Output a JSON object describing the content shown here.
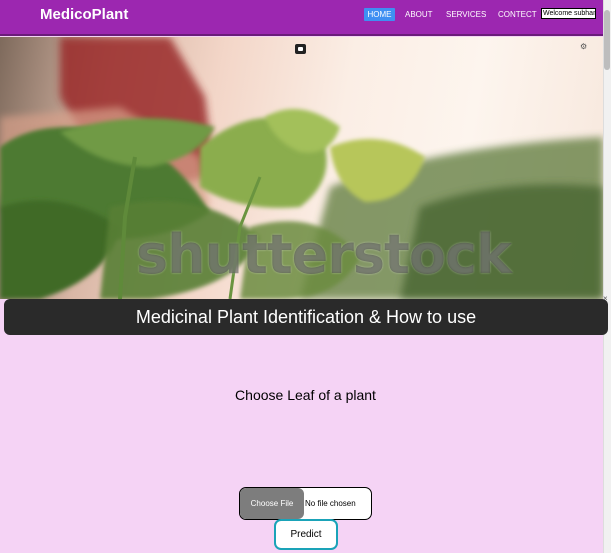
{
  "navbar": {
    "brand": "MedicoPlant",
    "items": [
      {
        "label": "HOME",
        "active": true
      },
      {
        "label": "ABOUT",
        "active": false
      },
      {
        "label": "SERVICES",
        "active": false
      },
      {
        "label": "CONTECT",
        "active": false
      }
    ],
    "welcome": "Welcome subham",
    "colors": {
      "bar": "#9c27b0",
      "active": "#3f8ff2"
    }
  },
  "hero": {
    "watermark": "shutterstock",
    "icons": [
      "image-icon",
      "settings-icon"
    ]
  },
  "main": {
    "title": "Medicinal Plant Identification & How to use",
    "choose_label": "Choose Leaf of a plant",
    "file_button": "Choose File",
    "file_status": "No file chosen",
    "predict_button": "Predict",
    "background": "#f5d3f5"
  }
}
